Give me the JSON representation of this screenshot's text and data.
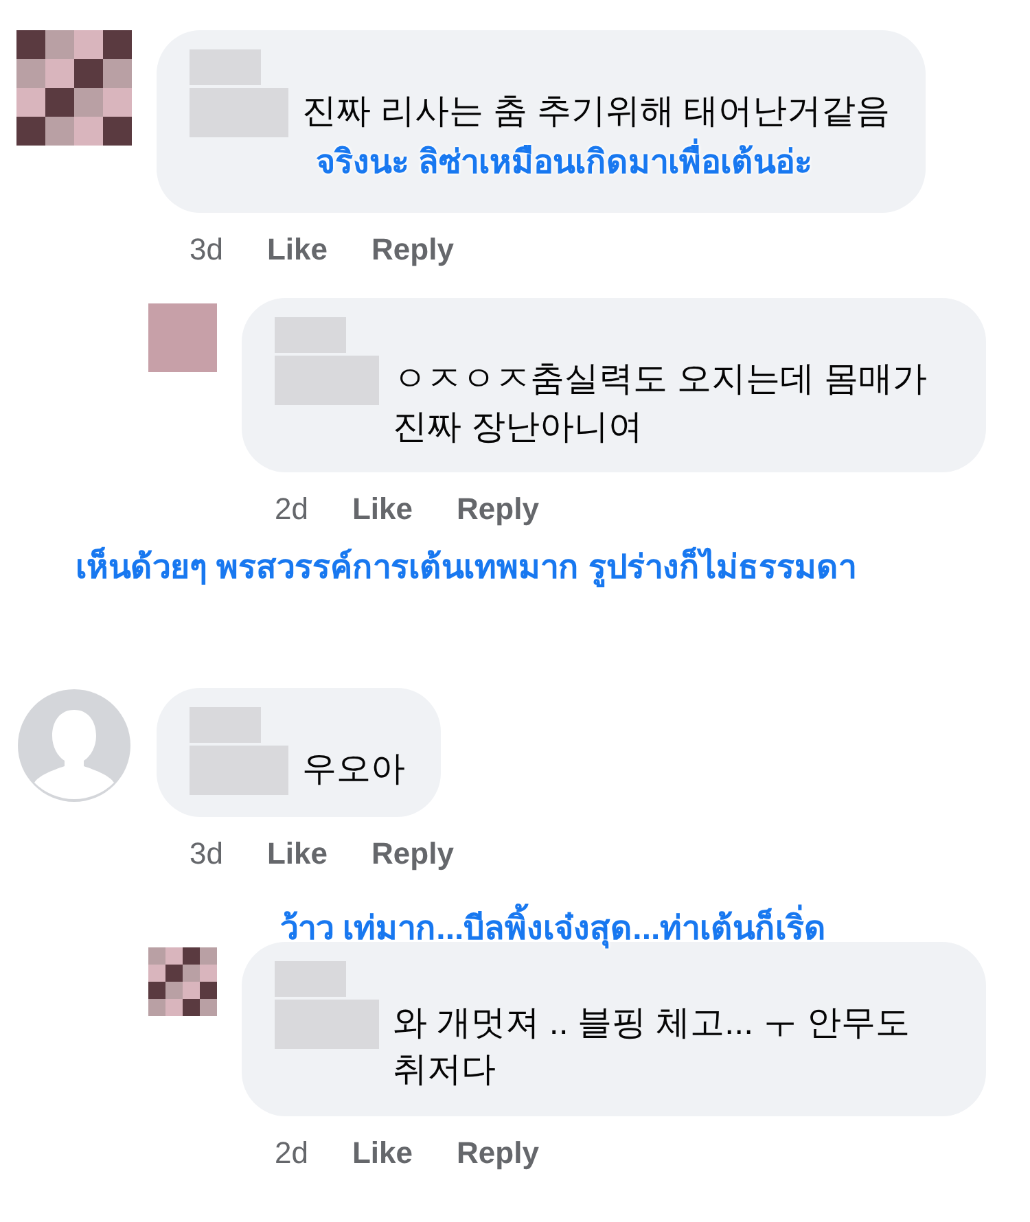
{
  "comments": [
    {
      "avatar": {
        "kind": "picture"
      },
      "text": "진짜 리사는 춤 추기위해 태어난거같음",
      "time": "3d",
      "like": "Like",
      "reply": "Reply",
      "translation": {
        "text": "จริงนะ  ลิซ่าเหมือนเกิดมาเพื่อเต้นอ่ะ",
        "kind": "inside"
      },
      "children": [
        {
          "avatar": {
            "kind": "picture"
          },
          "text": "ㅇㅈㅇㅈ춤실력도 오지는데 몸매가 진짜 장난아니여",
          "time": "2d",
          "like": "Like",
          "reply": "Reply",
          "translation": {
            "text": "เห็นด้วยๆ  พรสวรรค์การเต้นเทพมาก  รูปร่างก็ไม่ธรรมดา",
            "kind": "below"
          }
        }
      ]
    },
    {
      "avatar": {
        "kind": "default"
      },
      "text": "우오아",
      "time": "3d",
      "like": "Like",
      "reply": "Reply",
      "children": [
        {
          "avatar": {
            "kind": "picture"
          },
          "text": "와 개멋져 .. 블핑 체고... ㅜ 안무도 취저다",
          "time": "2d",
          "like": "Like",
          "reply": "Reply",
          "translation": {
            "text": "ว้าว  เท่มาก...บีลพิ้งเจ๋งสุด...ท่าเต้นก็เริ่ด",
            "kind": "above"
          }
        }
      ]
    }
  ]
}
